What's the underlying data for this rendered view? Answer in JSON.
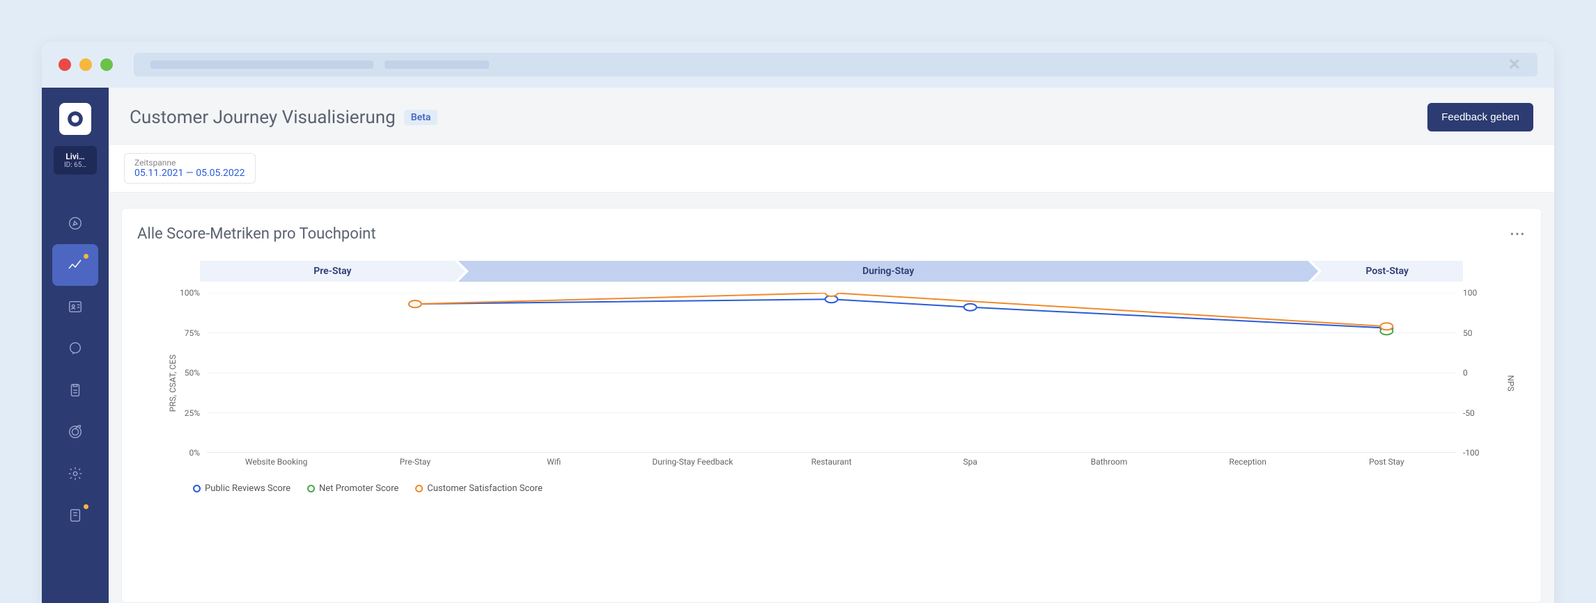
{
  "org": {
    "name": "Livi…",
    "id": "ID: 65…"
  },
  "header": {
    "title": "Customer Journey Visualisierung",
    "beta": "Beta",
    "feedback_button": "Feedback geben"
  },
  "filter": {
    "label": "Zeitspanne",
    "value": "05.11.2021 — 05.05.2022"
  },
  "chart": {
    "title": "Alle Score-Metriken pro Touchpoint",
    "phases": {
      "pre": "Pre-Stay",
      "during": "During-Stay",
      "post": "Post-Stay"
    },
    "y_left_label": "PRS, CSAT, CES",
    "y_right_label": "NPS",
    "y_left_ticks": [
      "100%",
      "75%",
      "50%",
      "25%",
      "0%"
    ],
    "y_right_ticks": [
      "100",
      "50",
      "0",
      "-50",
      "-100"
    ],
    "x_labels": [
      "Website Booking",
      "Pre-Stay",
      "Wifi",
      "During-Stay Feedback",
      "Restaurant",
      "Spa",
      "Bathroom",
      "Reception",
      "Post Stay"
    ],
    "legend": {
      "prs": "Public Reviews Score",
      "nps": "Net Promoter Score",
      "csat": "Customer Satisfaction Score"
    }
  },
  "chart_data": {
    "type": "line",
    "categories": [
      "Website Booking",
      "Pre-Stay",
      "Wifi",
      "During-Stay Feedback",
      "Restaurant",
      "Spa",
      "Bathroom",
      "Reception",
      "Post Stay"
    ],
    "y_left": {
      "label": "PRS, CSAT, CES",
      "unit": "%",
      "range": [
        0,
        100
      ]
    },
    "y_right": {
      "label": "NPS",
      "range": [
        -100,
        100
      ]
    },
    "series": [
      {
        "name": "Public Reviews Score",
        "axis": "left",
        "color": "#2a5bd7",
        "values": [
          null,
          93,
          null,
          null,
          96,
          91,
          null,
          null,
          78
        ]
      },
      {
        "name": "Net Promoter Score",
        "axis": "right",
        "color": "#4aa84a",
        "values": [
          null,
          null,
          null,
          null,
          null,
          null,
          null,
          null,
          52
        ]
      },
      {
        "name": "Customer Satisfaction Score",
        "axis": "left",
        "color": "#f08a2c",
        "values": [
          null,
          93,
          null,
          null,
          100,
          null,
          null,
          null,
          79
        ]
      }
    ],
    "phases": [
      {
        "label": "Pre-Stay",
        "span": [
          "Website Booking",
          "Pre-Stay"
        ]
      },
      {
        "label": "During-Stay",
        "span": [
          "Wifi",
          "Reception"
        ]
      },
      {
        "label": "Post-Stay",
        "span": [
          "Post Stay",
          "Post Stay"
        ]
      }
    ]
  },
  "colors": {
    "prs": "#2a5bd7",
    "nps": "#4aa84a",
    "csat": "#f08a2c"
  }
}
